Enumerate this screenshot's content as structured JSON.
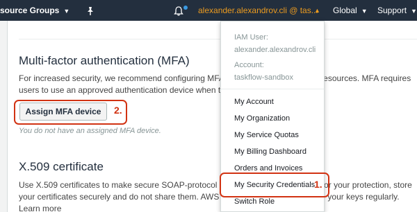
{
  "navbar": {
    "resource_groups": "source Groups",
    "pin_icon": "pin-icon",
    "bell_icon": "bell-icon",
    "account": "alexander.alexandrov.cli @ tas...",
    "global": "Global",
    "support": "Support"
  },
  "mfa": {
    "title": "Multi-factor authentication (MFA)",
    "description": "For increased security, we recommend configuring MFA to help protect your AWS resources. MFA requires users to use an approved authentication device when they sign in to AWS.",
    "button": "Assign MFA device",
    "button_step": "2.",
    "empty_text": "You do not have an assigned MFA device."
  },
  "x509": {
    "title": "X.509 certificate",
    "description": "Use X.509 certificates to make secure SOAP-protocol requests to AWS services. For your protection, store your certificates securely and do not share them. AWS recommends that you rotate your keys regularly. Learn more"
  },
  "account_menu": {
    "iam_user_label": "IAM User:",
    "iam_user_value": "alexander.alexandrov.cli",
    "account_label": "Account:",
    "account_value": "taskflow-sandbox",
    "items": [
      "My Account",
      "My Organization",
      "My Service Quotas",
      "My Billing Dashboard",
      "Orders and Invoices",
      "My Security Credentials",
      "Switch Role"
    ],
    "highlight_step": "1."
  },
  "colors": {
    "navbar_bg": "#232f3e",
    "account_text": "#ec9b1f",
    "highlight": "#d13212",
    "notification_dot": "#3b9ae1"
  }
}
